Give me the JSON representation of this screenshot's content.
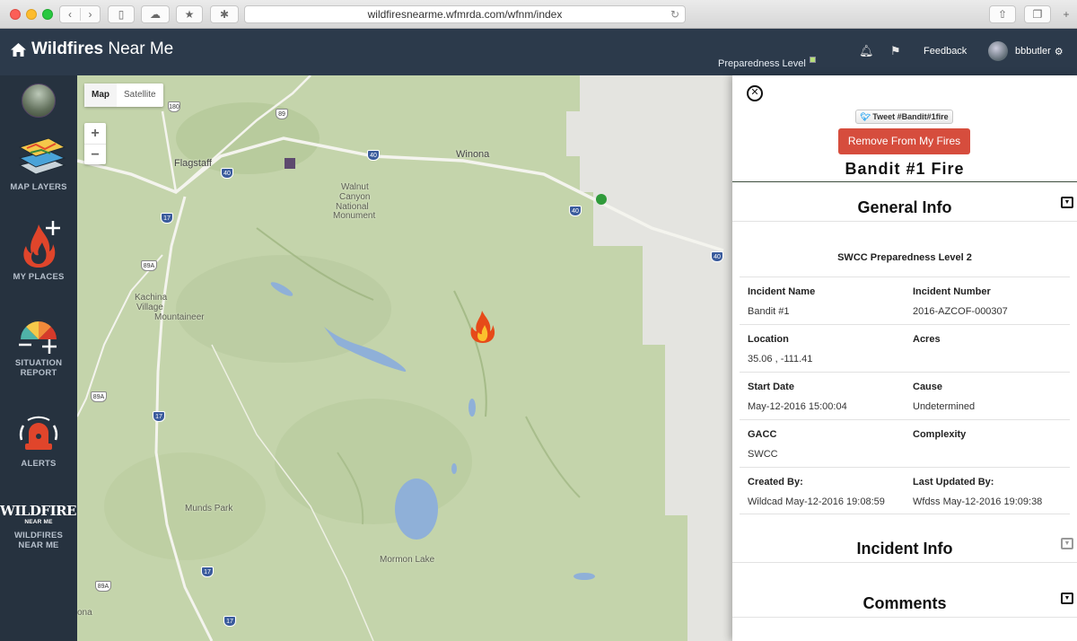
{
  "browser": {
    "url": "wildfiresnearme.wfmrda.com/wfnm/index"
  },
  "header": {
    "app_title_bold": "Wildfires",
    "app_title_rest": " Near Me",
    "preparedness_label": "Preparedness Level",
    "preparedness_color": "#b7e07a",
    "feedback_label": "Feedback",
    "username": "bbbutler"
  },
  "sidebar": {
    "items": [
      {
        "label": "MAP LAYERS"
      },
      {
        "label": "MY PLACES"
      },
      {
        "label": "SITUATION",
        "label2": "REPORT"
      },
      {
        "label": "ALERTS"
      },
      {
        "logo_text": "WILDFIRES",
        "logo_sub": "NEAR ME",
        "label": "WILDFIRES",
        "label2": "NEAR ME"
      }
    ]
  },
  "map": {
    "map_type": {
      "map": "Map",
      "satellite": "Satellite",
      "active": "Map"
    },
    "zoom_in": "+",
    "zoom_out": "−",
    "places": {
      "flagstaff": "Flagstaff",
      "winona": "Winona",
      "walnut": "Walnut",
      "canyon": "Canyon",
      "national": "National",
      "monument": "Monument",
      "kachina": "Kachina",
      "village": "Village",
      "mountaineer": "Mountaineer",
      "munds_park": "Munds Park",
      "mormon_lake": "Mormon Lake",
      "ona": "ona"
    },
    "shields": {
      "us180": "180",
      "us89": "89",
      "i40a": "40",
      "i40b": "40",
      "i40c": "40",
      "i40d": "40",
      "i40e": "40",
      "i17a": "17",
      "i17b": "17",
      "i17c": "17",
      "i17d": "17",
      "s89a_a": "89A",
      "s89a_b": "89A",
      "s89a_c": "89A"
    }
  },
  "panel": {
    "tweet_label": "Tweet #Bandit#1fire",
    "remove_label": "Remove From My Fires",
    "fire_title": "Bandit #1 Fire",
    "general_info_header": "General Info",
    "preparedness_line": "SWCC Preparedness Level 2",
    "fields": [
      [
        {
          "k": "Incident Name",
          "v": "Bandit #1"
        },
        {
          "k": "Incident Number",
          "v": "2016-AZCOF-000307"
        }
      ],
      [
        {
          "k": "Location",
          "v": "35.06 , -111.41"
        },
        {
          "k": "Acres",
          "v": ""
        }
      ],
      [
        {
          "k": "Start Date",
          "v": "May-12-2016 15:00:04"
        },
        {
          "k": "Cause",
          "v": "Undetermined"
        }
      ],
      [
        {
          "k": "GACC",
          "v": "SWCC"
        },
        {
          "k": "Complexity",
          "v": ""
        }
      ],
      [
        {
          "k": "Created By:",
          "v": "Wildcad May-12-2016 19:08:59"
        },
        {
          "k": "Last Updated By:",
          "v": "Wfdss May-12-2016 19:09:38"
        }
      ]
    ],
    "incident_info_header": "Incident Info",
    "comments_header": "Comments"
  },
  "colors": {
    "header_bg": "#2c3a4b",
    "sidebar_bg": "#26323f",
    "remove_button": "#d64d3d",
    "map_green": "#c5d5ad"
  }
}
